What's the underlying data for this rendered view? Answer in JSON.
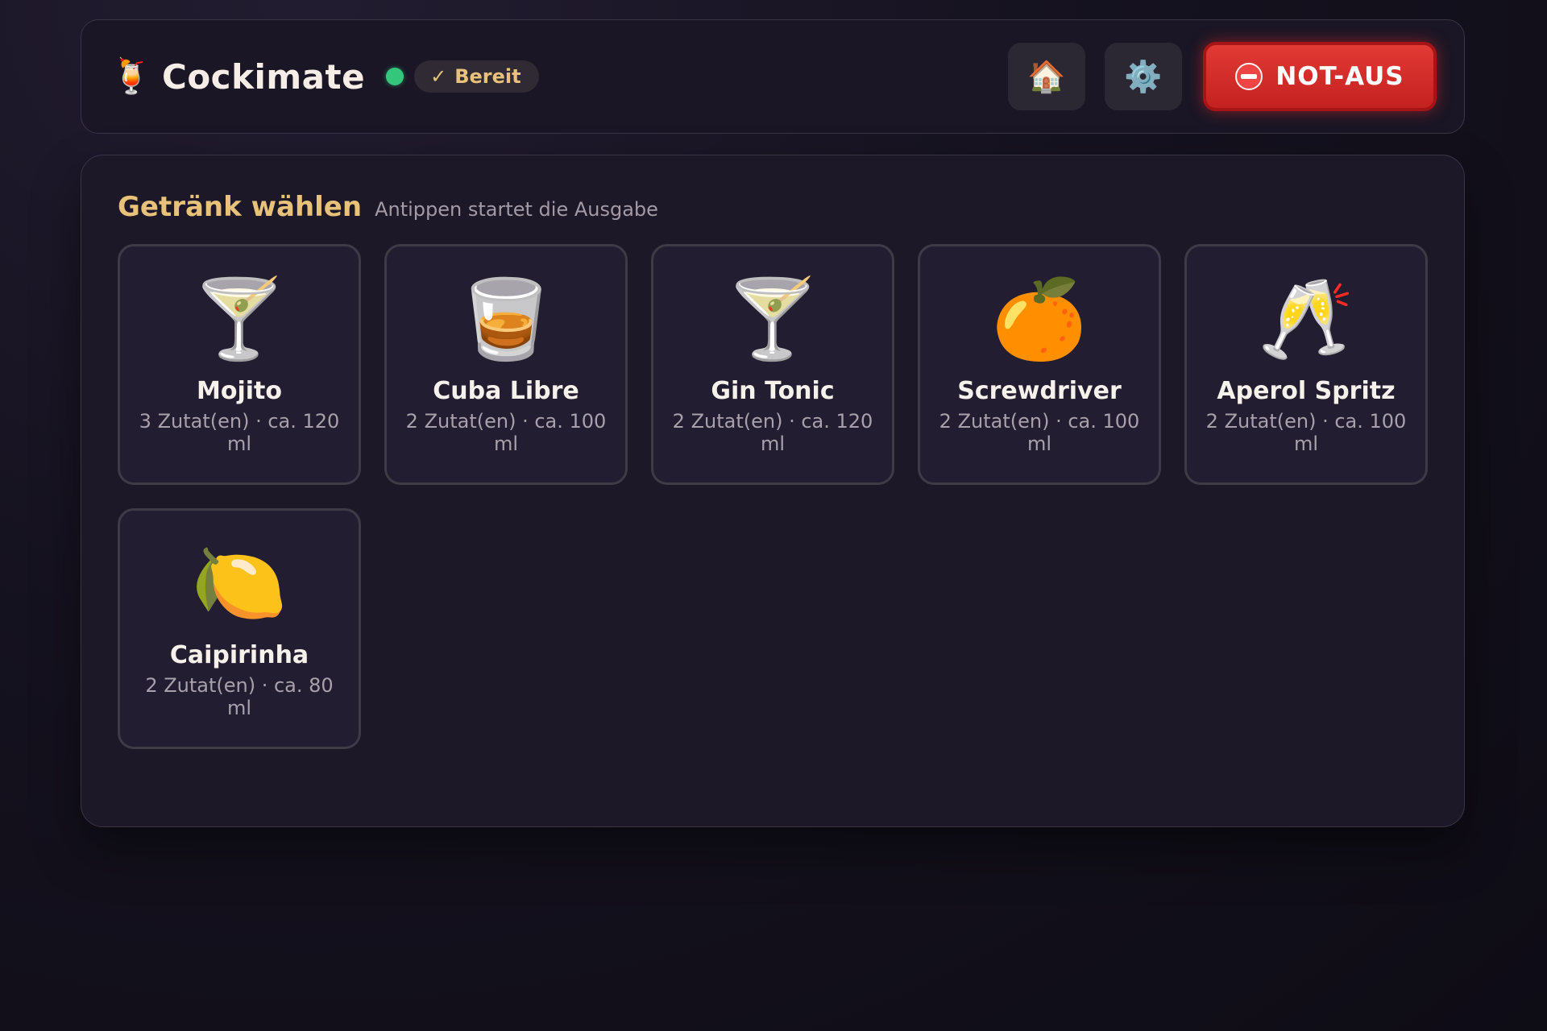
{
  "header": {
    "app_icon": "🍹",
    "app_title": "Cockimate",
    "status_dot_color": "#34c77b",
    "status_badge": {
      "check": "✓",
      "label": "Bereit",
      "color": "#e8c27a"
    },
    "home_button": {
      "icon": "🏠",
      "icon_name": "home-icon"
    },
    "settings_button": {
      "icon": "⚙️",
      "icon_name": "gear-icon"
    },
    "emergency_stop": {
      "label": "NOT-AUS",
      "icon_name": "stop-sign-icon",
      "color": "#d72a27"
    }
  },
  "panel": {
    "title": "Getränk wählen",
    "title_color": "#e8c27a",
    "subtitle": "Antippen startet die Ausgabe"
  },
  "drinks": [
    {
      "icon": "🍸",
      "icon_name": "cocktail-glass-icon",
      "name": "Mojito",
      "meta": "3 Zutat(en) · ca. 120 ml"
    },
    {
      "icon": "🥃",
      "icon_name": "tumbler-glass-icon",
      "name": "Cuba Libre",
      "meta": "2 Zutat(en) · ca. 100 ml"
    },
    {
      "icon": "🍸",
      "icon_name": "cocktail-glass-icon",
      "name": "Gin Tonic",
      "meta": "2 Zutat(en) · ca. 120 ml"
    },
    {
      "icon": "🍊",
      "icon_name": "orange-icon",
      "name": "Screwdriver",
      "meta": "2 Zutat(en) · ca. 100 ml"
    },
    {
      "icon": "🥂",
      "icon_name": "clinking-glasses-icon",
      "name": "Aperol Spritz",
      "meta": "2 Zutat(en) · ca. 100 ml"
    },
    {
      "icon": "🍋",
      "icon_name": "lemon-icon",
      "name": "Caipirinha",
      "meta": "2 Zutat(en) · ca. 80 ml"
    }
  ]
}
